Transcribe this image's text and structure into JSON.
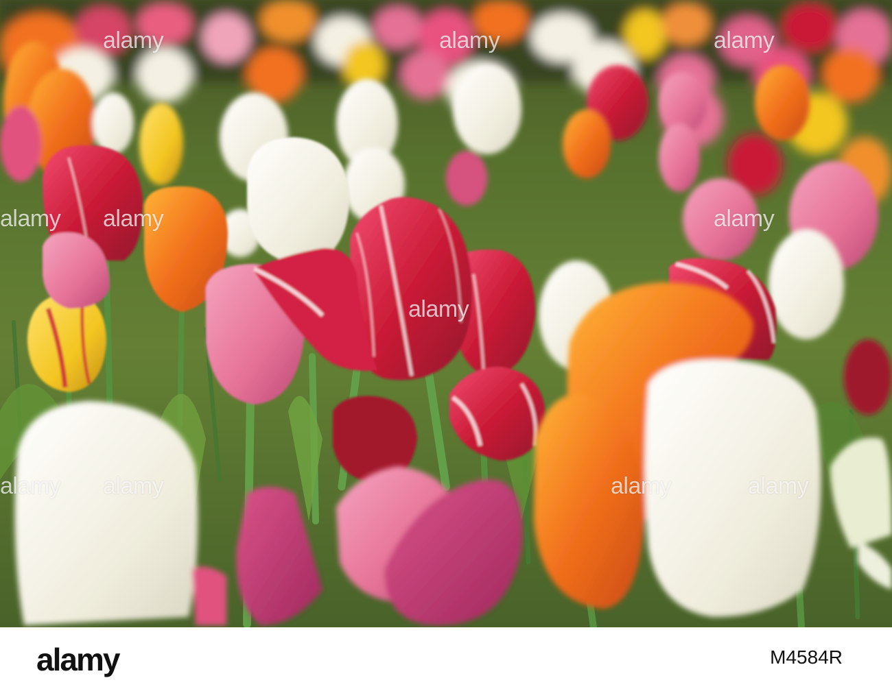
{
  "photo": {
    "subject": "tulip-field",
    "colors": {
      "red": "#c8102e",
      "pink": "#e46a92",
      "white": "#f4f1e4",
      "orange": "#f26a12",
      "yellow": "#f3c318",
      "green": "#4f6a24"
    }
  },
  "watermark": {
    "text": "alamy"
  },
  "footer": {
    "logo": "alamy",
    "image_id": "M4584R"
  }
}
